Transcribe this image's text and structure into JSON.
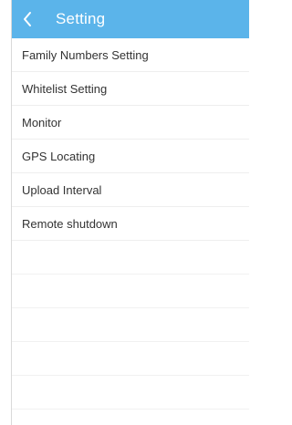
{
  "header": {
    "title": "Setting",
    "back_icon": "chevron-left-icon"
  },
  "menu": {
    "items": [
      {
        "label": "Family Numbers Setting"
      },
      {
        "label": "Whitelist Setting"
      },
      {
        "label": "Monitor"
      },
      {
        "label": "GPS Locating"
      },
      {
        "label": "Upload Interval"
      },
      {
        "label": "Remote shutdown"
      }
    ]
  },
  "colors": {
    "header_bg": "#5bb4ea",
    "header_text": "#ffffff",
    "item_text": "#333333",
    "divider": "#eeeeee"
  }
}
